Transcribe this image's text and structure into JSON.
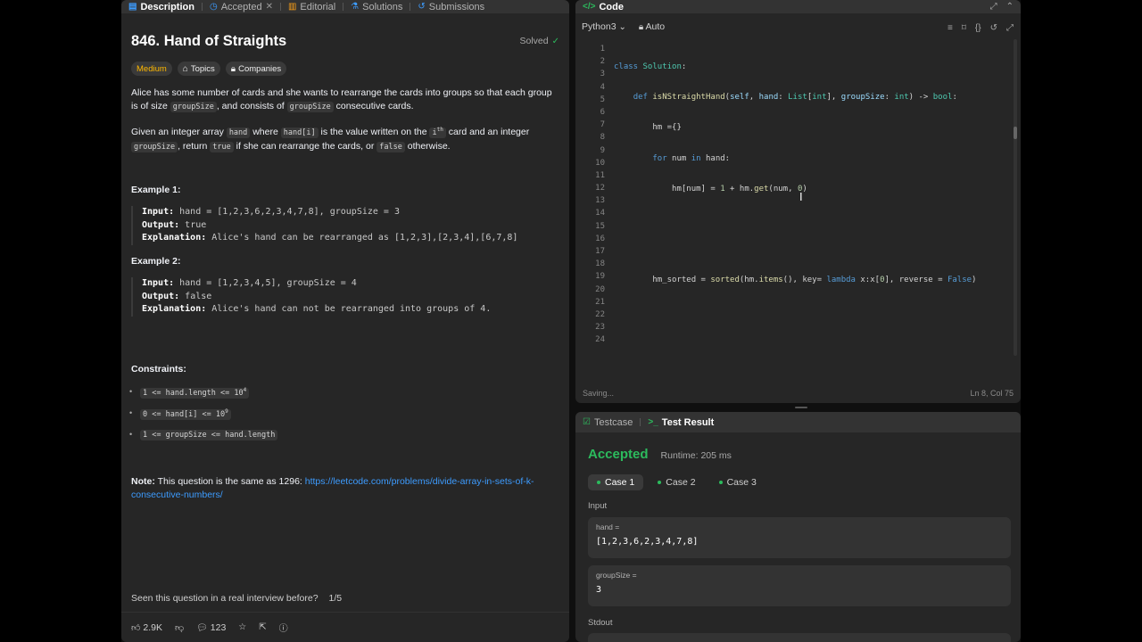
{
  "left": {
    "tabs": [
      {
        "label": "Description",
        "icon": "description-icon"
      },
      {
        "label": "Accepted",
        "icon": "clock-icon"
      },
      {
        "label": "Editorial",
        "icon": "book-icon"
      },
      {
        "label": "Solutions",
        "icon": "flask-icon"
      },
      {
        "label": "Submissions",
        "icon": "history-icon"
      }
    ],
    "title": "846. Hand of Straights",
    "solved": "Solved",
    "chips": {
      "difficulty": "Medium",
      "topics": "Topics",
      "companies": "Companies"
    },
    "para1": {
      "a": "Alice has some number of cards and she wants to rearrange the cards into groups so that each group is of size ",
      "code1": "groupSize",
      "b": ", and consists of ",
      "code2": "groupSize",
      "c": " consecutive cards."
    },
    "para2": {
      "a": "Given an integer array ",
      "code1": "hand",
      "b": " where ",
      "code2": "hand[i]",
      "c": " is the value written on the ",
      "code3": "i",
      "sup": "th",
      "d": " card and an integer ",
      "code4": "groupSize",
      "e": ", return ",
      "code5": "true",
      "f": " if she can rearrange the cards, or ",
      "code6": "false",
      "g": " otherwise."
    },
    "ex1": {
      "head": "Example 1:",
      "input_k": "Input:",
      "input_v": " hand = [1,2,3,6,2,3,4,7,8], groupSize = 3",
      "output_k": "Output:",
      "output_v": " true",
      "expl_k": "Explanation:",
      "expl_v": " Alice's hand can be rearranged as [1,2,3],[2,3,4],[6,7,8]"
    },
    "ex2": {
      "head": "Example 2:",
      "input_k": "Input:",
      "input_v": " hand = [1,2,3,4,5], groupSize = 4",
      "output_k": "Output:",
      "output_v": " false",
      "expl_k": "Explanation:",
      "expl_v": " Alice's hand can not be rearranged into groups of 4."
    },
    "constraints": {
      "head": "Constraints:",
      "c1": "1 <= hand.length <= 10",
      "c1sup": "4",
      "c2": "0 <= hand[i] <= 10",
      "c2sup": "9",
      "c3": "1 <= groupSize <= hand.length"
    },
    "note": {
      "label": "Note:",
      "text": " This question is the same as 1296: ",
      "link": "https://leetcode.com/problems/divide-array-in-sets-of-k-consecutive-numbers/"
    },
    "seen": {
      "text": "Seen this question in a real interview before?",
      "count": "1/5"
    },
    "bottom": {
      "likes": "2.9K",
      "comments": "123"
    }
  },
  "code": {
    "tab": "Code",
    "language": "Python3",
    "mode": "Auto",
    "status": "Saving...",
    "position": "Ln 8, Col 75",
    "line_numbers": [
      "1",
      "2",
      "3",
      "4",
      "5",
      "6",
      "7",
      "8",
      "9",
      "10",
      "11",
      "12",
      "13",
      "14",
      "15",
      "16",
      "17",
      "18",
      "19",
      "20",
      "21",
      "22",
      "23",
      "24"
    ],
    "lines": [
      "class Solution:",
      "    def isNStraightHand(self, hand: List[int], groupSize: int) -> bool:",
      "        hm ={}",
      "        for num in hand:",
      "            hm[num] = 1 + hm.get(num, 0)",
      "",
      "",
      "        hm_sorted = sorted(hm.items(), key= lambda x:x[0], reverse = False)"
    ]
  },
  "result": {
    "tabs": {
      "testcase": "Testcase",
      "test_result": "Test Result"
    },
    "status": "Accepted",
    "runtime": "Runtime: 205 ms",
    "cases": [
      "Case 1",
      "Case 2",
      "Case 3"
    ],
    "input_label": "Input",
    "hand_label": "hand =",
    "hand_value": "[1,2,3,6,2,3,4,7,8]",
    "group_label": "groupSize =",
    "group_value": "3",
    "stdout_label": "Stdout"
  },
  "colors": {
    "accent_green": "#2cbb5d",
    "medium": "#ffb800",
    "link": "#3d9cff"
  }
}
